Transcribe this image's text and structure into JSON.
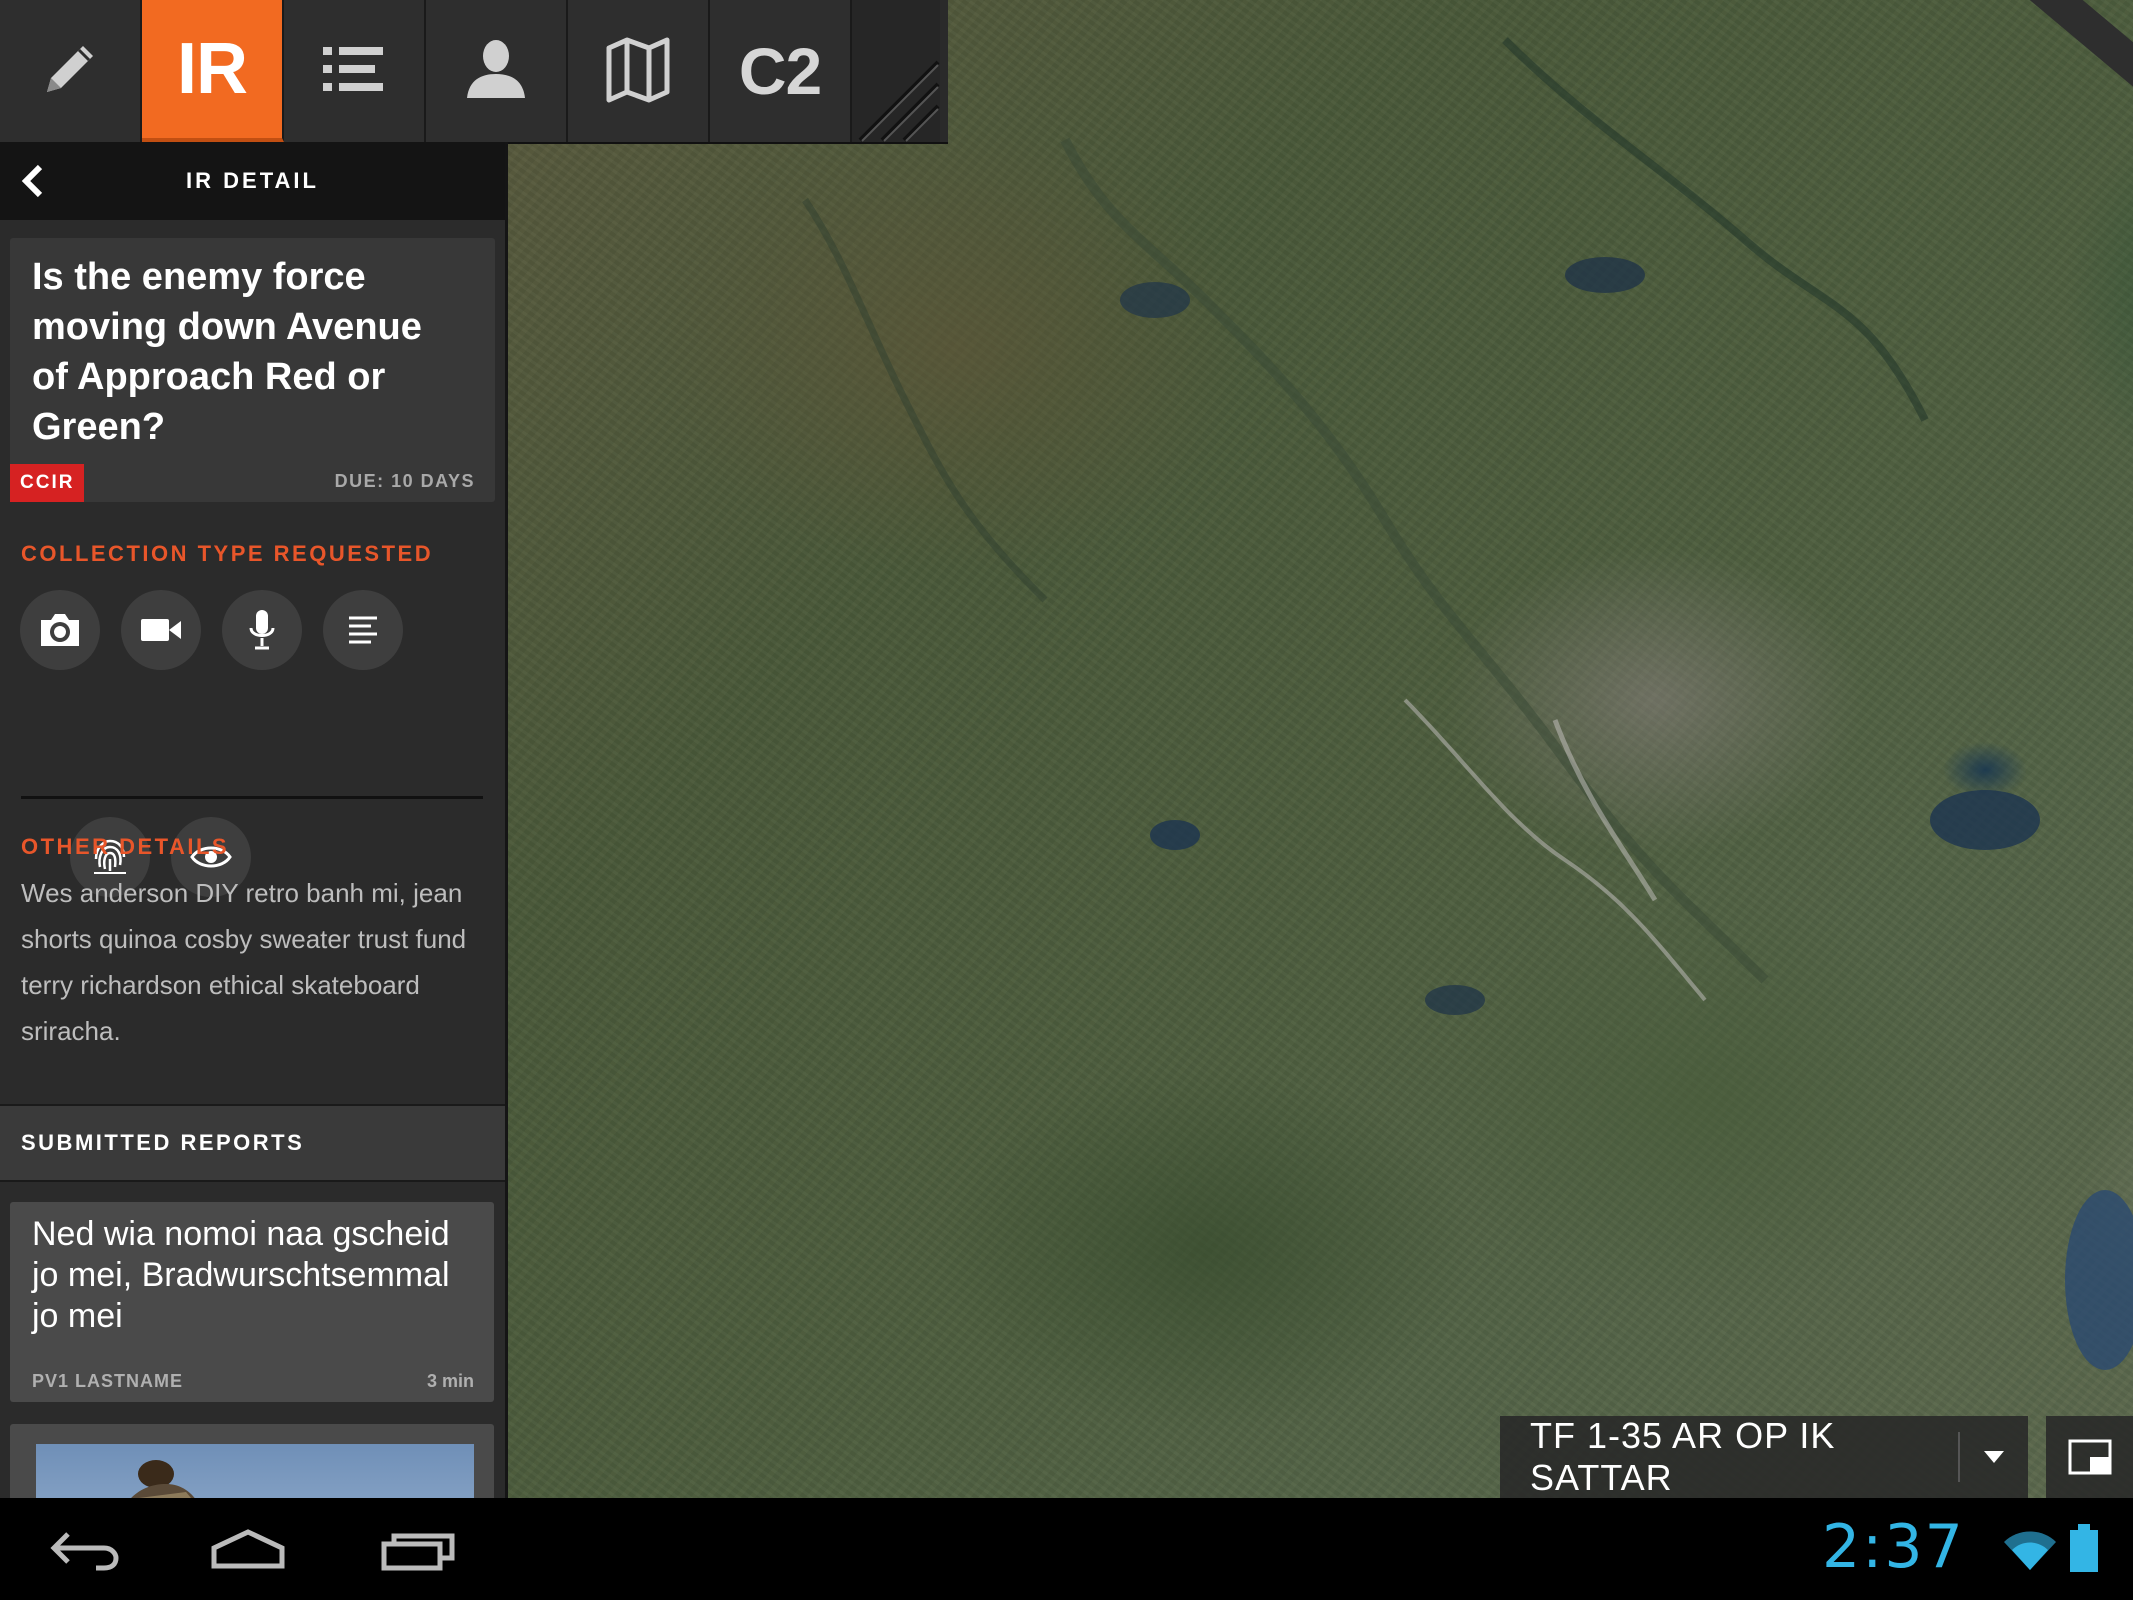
{
  "tabs": [
    {
      "name": "tab-edit",
      "icon": "pencil-icon",
      "label": ""
    },
    {
      "name": "tab-ir",
      "icon": "",
      "label": "IR",
      "active": true
    },
    {
      "name": "tab-list",
      "icon": "list-icon",
      "label": ""
    },
    {
      "name": "tab-profile",
      "icon": "person-icon",
      "label": ""
    },
    {
      "name": "tab-map",
      "icon": "map-icon",
      "label": ""
    },
    {
      "name": "tab-c2",
      "icon": "",
      "label": "C2"
    }
  ],
  "accent_color": "#f26a21",
  "detail": {
    "title": "IR DETAIL",
    "question": "Is the enemy force moving down Avenue of Approach Red or Green?",
    "badge": "CCIR",
    "badge_color": "#d62222",
    "due": "DUE: 10 DAYS"
  },
  "collection": {
    "title": "COLLECTION TYPE REQUESTED",
    "types": [
      "camera-icon",
      "video-icon",
      "microphone-icon",
      "text-icon",
      "fingerprint-icon",
      "eye-icon"
    ]
  },
  "other": {
    "title": "OTHER DETAILS",
    "text": "Wes anderson DIY retro banh mi, jean shorts quinoa cosby sweater trust fund terry richardson ethical skateboard sriracha."
  },
  "reports": {
    "title": "SUBMITTED REPORTS",
    "items": [
      {
        "text": "Ned wia nomoi naa gscheid jo mei, Bradwurschtsemmal jo mei",
        "author": "PV1 LASTNAME",
        "time": "3 min"
      }
    ]
  },
  "map": {
    "operation": "TF 1-35 AR OP IK SATTAR"
  },
  "system": {
    "clock": "2:37",
    "clock_color": "#33b5e5"
  }
}
